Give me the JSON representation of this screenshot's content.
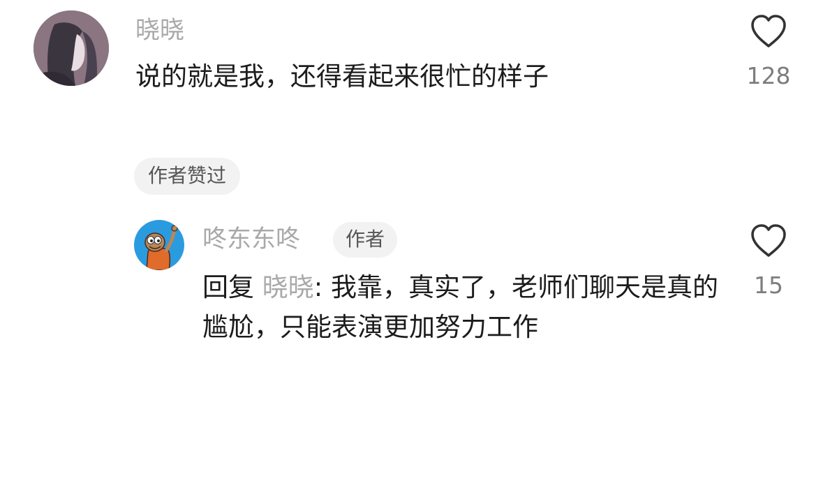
{
  "main_comment": {
    "avatar_icon": "user-avatar-icon",
    "username": "晓晓",
    "text": "说的就是我，还得看起来很忙的样子",
    "like_count": "128",
    "like_icon": "heart-outline-icon",
    "author_liked_badge": "作者赞过"
  },
  "reply": {
    "avatar_icon": "user-avatar-icon",
    "username": "咚东东咚",
    "author_badge": "作者",
    "prefix": "回复",
    "target": "晓晓",
    "text": ": 我靠，真实了，老师们聊天是真的尴尬，只能表演更加努力工作",
    "like_count": "15",
    "like_icon": "heart-outline-icon"
  },
  "colors": {
    "username": "#a9a9a9",
    "text": "#1c1c1c",
    "badge_bg": "#f2f2f2",
    "reply_avatar_bg": "#2b9be0"
  }
}
